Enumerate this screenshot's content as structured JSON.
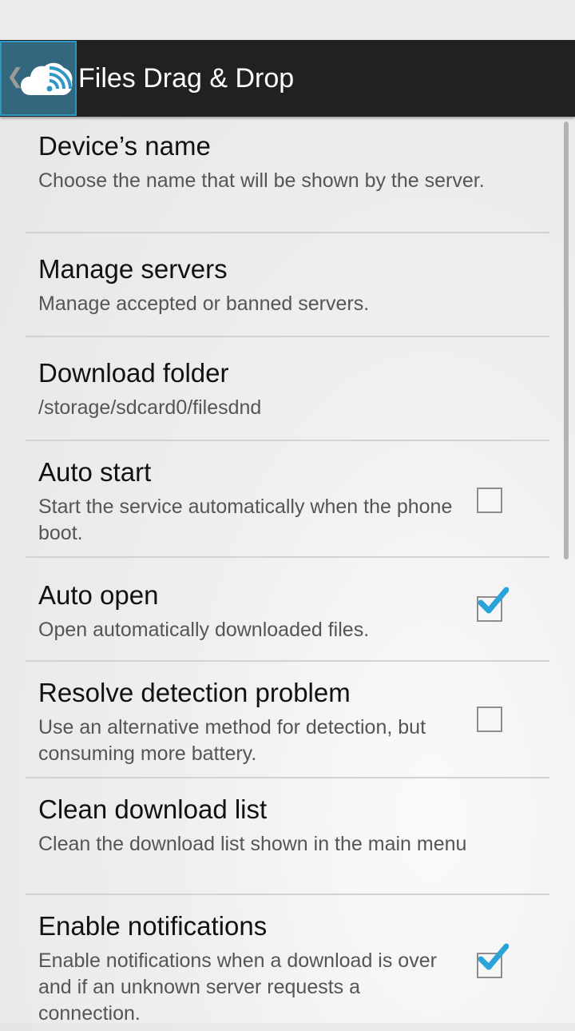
{
  "app": {
    "title": "Files Drag & Drop",
    "icon": "cloud-wifi-icon",
    "up_icon": "chevron-left-icon"
  },
  "colors": {
    "action_bar": "#212121",
    "home_highlight": "#33677e",
    "home_border": "#2f97c4",
    "check_accent": "#2aa3d8"
  },
  "preferences": [
    {
      "title": "Device’s name",
      "summary": "Choose the name that will be shown by the server."
    },
    {
      "title": "Manage servers",
      "summary": "Manage accepted or banned servers."
    },
    {
      "title": "Download folder",
      "summary": "/storage/sdcard0/filesdnd"
    },
    {
      "title": "Auto start",
      "summary": "Start the service automatically when the phone boot.",
      "checked": false
    },
    {
      "title": "Auto open",
      "summary": "Open automatically downloaded files.",
      "checked": true
    },
    {
      "title": "Resolve detection problem",
      "summary": "Use an alternative method for detection, but consuming more battery.",
      "checked": false
    },
    {
      "title": "Clean download list",
      "summary": "Clean the download list shown in the main menu"
    },
    {
      "title": "Enable notifications",
      "summary": "Enable notifications when a download is over and if an unknown server requests a connection.",
      "checked": true
    }
  ]
}
